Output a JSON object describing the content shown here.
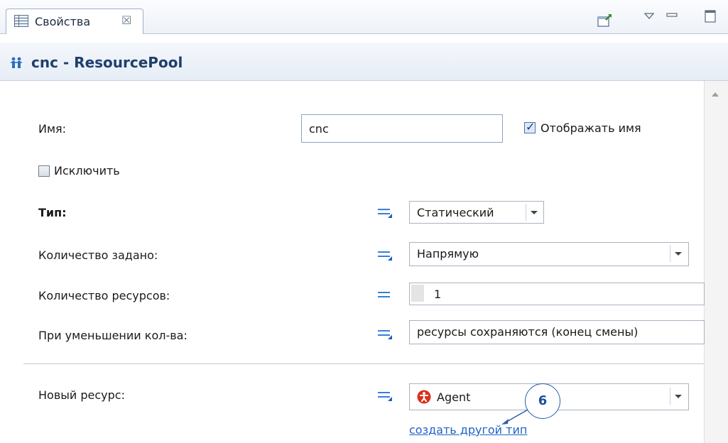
{
  "tab": {
    "label": "Свойства",
    "close_glyph": "☒"
  },
  "toolbar": {
    "icons": [
      "pin-to-editor-icon",
      "view-menu-icon",
      "minimize-icon",
      "maximize-icon"
    ]
  },
  "header": {
    "title": "cnc - ResourcePool",
    "icon": "resource-pool-icon"
  },
  "form": {
    "name_label": "Имя:",
    "name_value": "cnc",
    "show_name_label": "Отображать имя",
    "show_name_checked": true,
    "exclude_label": "Исключить",
    "exclude_checked": false,
    "type_label": "Тип:",
    "type_value": "Статический",
    "quantity_defined_label": "Количество задано:",
    "quantity_defined_value": "Напрямую",
    "resource_count_label": "Количество ресурсов:",
    "resource_count_value": "1",
    "on_decrease_label": "При уменьшении кол-ва:",
    "on_decrease_value": "ресурсы сохраняются (конец смены)",
    "new_resource_label": "Новый ресурс:",
    "new_resource_value": "Agent",
    "create_type_link": "создать другой тип"
  },
  "callout": {
    "number": "6"
  },
  "colors": {
    "accent": "#1f63c6",
    "header_text": "#1f3f6b",
    "agent_icon": "#d8321f",
    "eq_icon": "#3b7dd8"
  }
}
